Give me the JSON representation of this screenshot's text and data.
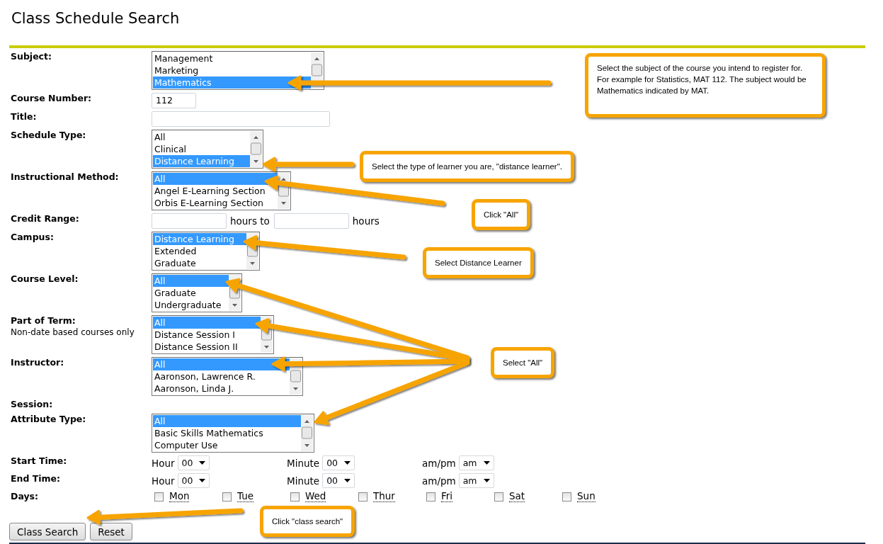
{
  "title": "Class Schedule Search",
  "fields": [
    {
      "kind": "listbox",
      "label": "Subject:",
      "options": [
        {
          "text": "Management",
          "selected": false
        },
        {
          "text": "Marketing",
          "selected": false
        },
        {
          "text": "Mathematics",
          "selected": true
        }
      ]
    },
    {
      "kind": "text",
      "label": "Course Number:",
      "value": "112"
    },
    {
      "kind": "text",
      "label": "Title:"
    },
    {
      "kind": "listbox",
      "label": "Schedule Type:",
      "options": [
        {
          "text": "All",
          "selected": false
        },
        {
          "text": "Clinical",
          "selected": false
        },
        {
          "text": "Distance Learning",
          "selected": true
        }
      ]
    },
    {
      "kind": "listbox",
      "label": "Instructional Method:",
      "options": [
        {
          "text": "All",
          "selected": true
        },
        {
          "text": "Angel E-Learning Section",
          "selected": false
        },
        {
          "text": "Orbis E-Learning Section",
          "selected": false
        }
      ]
    },
    {
      "kind": "range",
      "label": "Credit Range:",
      "units": [
        "hours to",
        "hours"
      ]
    },
    {
      "kind": "listbox",
      "label": "Campus:",
      "options": [
        {
          "text": "Distance Learning",
          "selected": true
        },
        {
          "text": "Extended",
          "selected": false
        },
        {
          "text": "Graduate",
          "selected": false
        }
      ]
    },
    {
      "kind": "listbox",
      "label": "Course Level:",
      "options": [
        {
          "text": "All",
          "selected": true
        },
        {
          "text": "Graduate",
          "selected": false
        },
        {
          "text": "Undergraduate",
          "selected": false
        }
      ]
    },
    {
      "kind": "listbox",
      "label": "Part of Term:",
      "sublabel": "Non-date based courses only",
      "options": [
        {
          "text": "All",
          "selected": true
        },
        {
          "text": "Distance Session I",
          "selected": false
        },
        {
          "text": "Distance Session II",
          "selected": false
        }
      ]
    },
    {
      "kind": "listbox",
      "label": "Instructor:",
      "options": [
        {
          "text": "All",
          "selected": true
        },
        {
          "text": "Aaronson, Lawrence R.",
          "selected": false
        },
        {
          "text": "Aaronson, Linda J.",
          "selected": false
        }
      ]
    },
    {
      "kind": "none",
      "label": "Session:"
    },
    {
      "kind": "listbox",
      "label": "Attribute Type:",
      "options": [
        {
          "text": "All",
          "selected": true
        },
        {
          "text": "Basic Skills Mathematics",
          "selected": false
        },
        {
          "text": "Computer Use",
          "selected": false
        }
      ]
    },
    {
      "kind": "time",
      "label": "Start Time:",
      "parts": [
        {
          "label": "Hour",
          "value": "00"
        },
        {
          "label": "Minute",
          "value": "00"
        },
        {
          "label": "am/pm",
          "value": "am"
        }
      ]
    },
    {
      "kind": "time",
      "label": "End Time:",
      "parts": [
        {
          "label": "Hour",
          "value": "00"
        },
        {
          "label": "Minute",
          "value": "00"
        },
        {
          "label": "am/pm",
          "value": "am"
        }
      ]
    },
    {
      "kind": "days",
      "label": "Days:",
      "days": [
        {
          "label": "Mon",
          "checked": false
        },
        {
          "label": "Tue",
          "checked": false
        },
        {
          "label": "Wed",
          "checked": false
        },
        {
          "label": "Thur",
          "checked": false
        },
        {
          "label": "Fri",
          "checked": false
        },
        {
          "label": "Sat",
          "checked": false
        },
        {
          "label": "Sun",
          "checked": false
        }
      ]
    }
  ],
  "buttons": [
    "Class Search",
    "Reset"
  ],
  "callouts": [
    {
      "text": "Select the subject of the course you intend to register for. For example for Statistics, MAT 112. The subject would be Mathematics indicated by MAT."
    },
    {
      "text": "Select the type of learner you are, \"distance learner\"."
    },
    {
      "text": "Click \"All\""
    },
    {
      "text": "Select Distance Learner"
    },
    {
      "text": "Select \"All\""
    },
    {
      "text": "Click \"class search\""
    }
  ]
}
